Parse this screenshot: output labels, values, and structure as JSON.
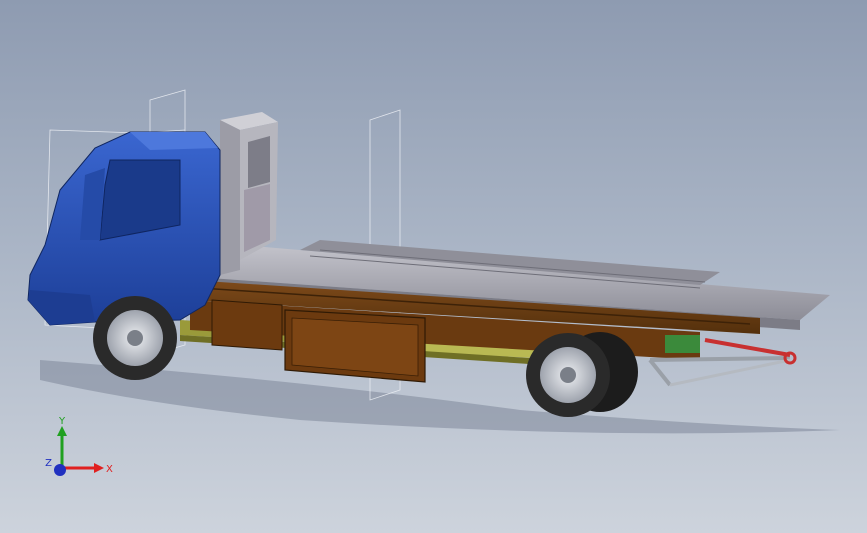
{
  "window": {
    "title": ""
  },
  "triad": {
    "x_label": "X",
    "y_label": "Y",
    "z_label": "Z",
    "x_color": "#e02020",
    "y_color": "#20a020",
    "z_color": "#2030c0"
  },
  "model": {
    "name": "",
    "cab_color": "#2c55b8",
    "bed_color": "#a9a9b2",
    "frame_color": "#6b3c12",
    "chassis_color": "#9a9a3a",
    "hydraulic_color": "#c83030",
    "tire_color": "#2a2a2a",
    "rim_color": "#c9ccd2"
  }
}
